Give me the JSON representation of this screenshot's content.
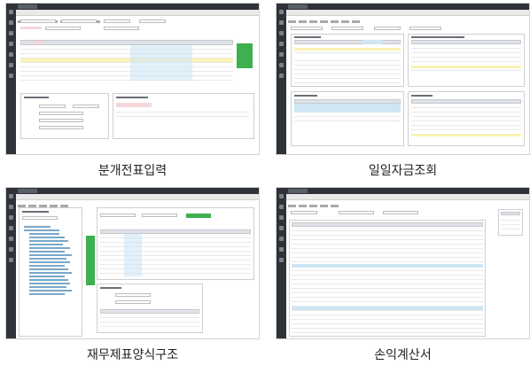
{
  "captions": {
    "split_voucher_entry": "분개전표입력",
    "daily_fund_inquiry": "일일자금조회",
    "financial_statement_structure": "재무제표양식구조",
    "income_statement": "손익계산서"
  }
}
